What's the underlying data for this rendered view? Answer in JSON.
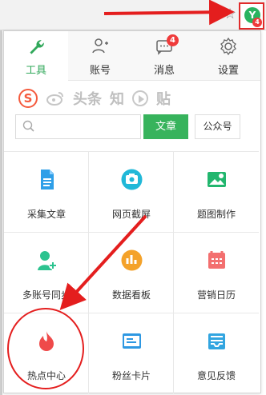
{
  "extension": {
    "badge": "4",
    "icon": "Y"
  },
  "tabs": [
    {
      "label": "工具",
      "icon": "wrench-icon",
      "active": true
    },
    {
      "label": "账号",
      "icon": "user-icon"
    },
    {
      "label": "消息",
      "icon": "message-icon",
      "badge": "4"
    },
    {
      "label": "设置",
      "icon": "gear-icon"
    }
  ],
  "sites": {
    "sohu": "S",
    "toutiao": "头条",
    "zhihu": "知",
    "tieba": "贴"
  },
  "search": {
    "placeholder": "",
    "button": "文章",
    "type": "公众号"
  },
  "tools": [
    {
      "label": "采集文章",
      "icon": "document-icon",
      "color": "#2f9fe8"
    },
    {
      "label": "网页截屏",
      "icon": "camera-icon",
      "color": "#21b8d8"
    },
    {
      "label": "题图制作",
      "icon": "image-icon",
      "color": "#22b66e"
    },
    {
      "label": "多账号同步",
      "icon": "user-add-icon",
      "color": "#2cc38f"
    },
    {
      "label": "数据看板",
      "icon": "bar-chart-icon",
      "color": "#f4a22a"
    },
    {
      "label": "营销日历",
      "icon": "calendar-icon",
      "color": "#f36f6f"
    },
    {
      "label": "热点中心",
      "icon": "flame-icon",
      "color": "#ef4a4a"
    },
    {
      "label": "粉丝卡片",
      "icon": "card-icon",
      "color": "#2e98e2"
    },
    {
      "label": "意见反馈",
      "icon": "inbox-icon",
      "color": "#32a5e0"
    }
  ]
}
